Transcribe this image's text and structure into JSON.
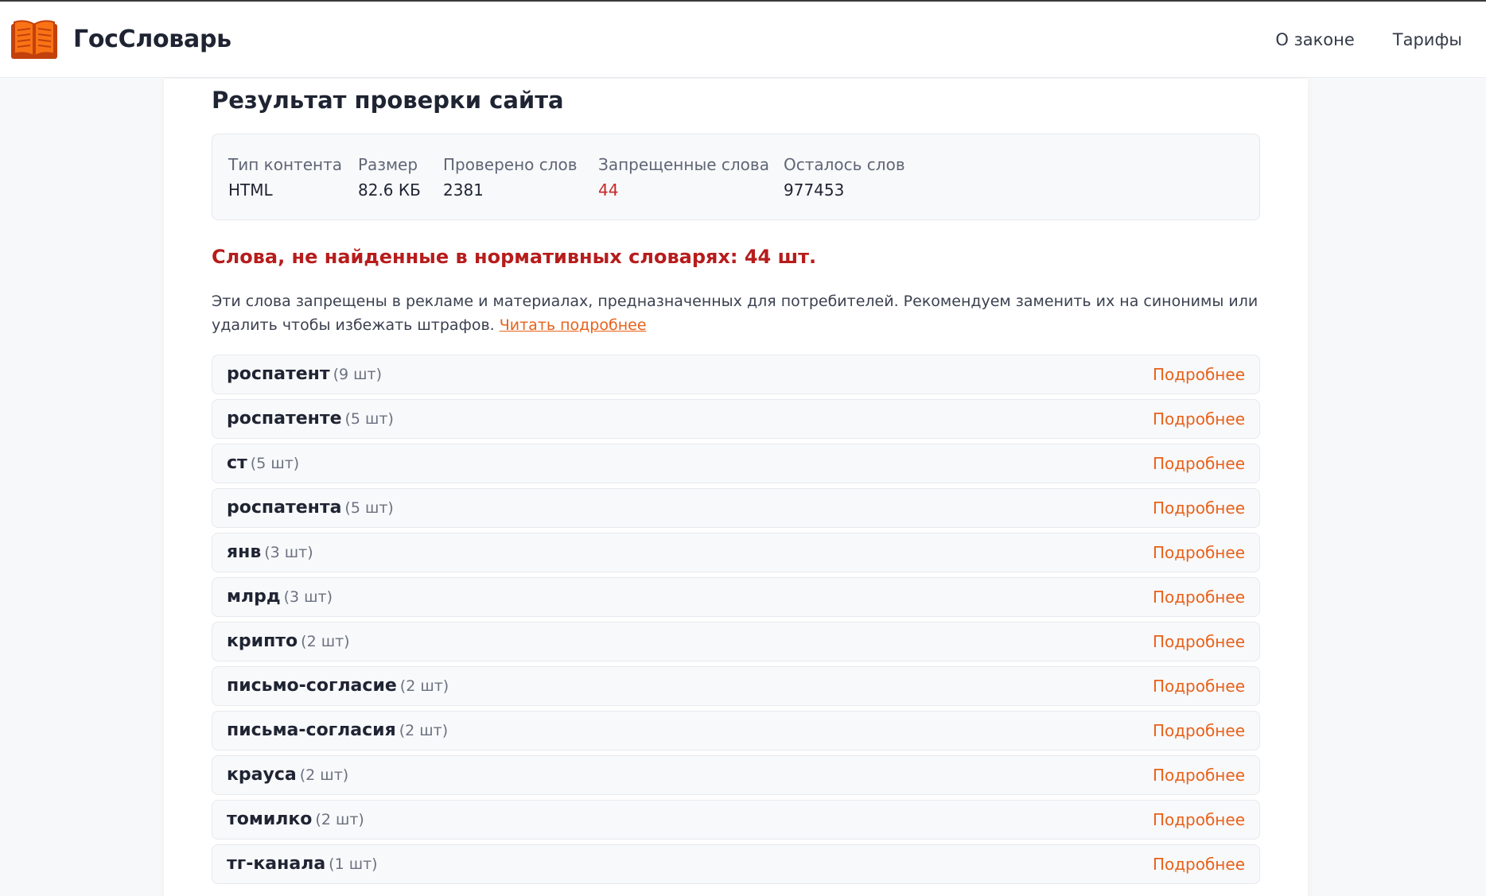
{
  "app": {
    "logo_text": "ГосСловарь",
    "logo_icon": "open-book-icon",
    "accent_color": "#e8611a",
    "danger_color": "#c62828"
  },
  "nav": {
    "items": [
      {
        "label": "О законе"
      },
      {
        "label": "Тарифы"
      }
    ]
  },
  "page": {
    "title": "Результат проверки сайта"
  },
  "stats": [
    {
      "label": "Тип контента",
      "value": "HTML"
    },
    {
      "label": "Размер",
      "value": "82.6 КБ"
    },
    {
      "label": "Проверено слов",
      "value": "2381"
    },
    {
      "label": "Запрещенные слова",
      "value": "44"
    },
    {
      "label": "Осталось слов",
      "value": "977453"
    }
  ],
  "warning": {
    "title": "Слова, не найденные в нормативных словарях: 44 шт.",
    "text": "Эти слова запрещены в рекламе и материалах, предназначенных для потребителей. Рекомендуем заменить их на синонимы или удалить чтобы избежать штрафов.",
    "link_label": "Читать подробнее"
  },
  "words": {
    "more_label": "Подробнее",
    "items": [
      {
        "word": "роспатент",
        "count": "(9 шт)"
      },
      {
        "word": "роспатенте",
        "count": "(5 шт)"
      },
      {
        "word": "ст",
        "count": "(5 шт)"
      },
      {
        "word": "роспатента",
        "count": "(5 шт)"
      },
      {
        "word": "янв",
        "count": "(3 шт)"
      },
      {
        "word": "млрд",
        "count": "(3 шт)"
      },
      {
        "word": "крипто",
        "count": "(2 шт)"
      },
      {
        "word": "письмо-согласие",
        "count": "(2 шт)"
      },
      {
        "word": "письма-согласия",
        "count": "(2 шт)"
      },
      {
        "word": "крауса",
        "count": "(2 шт)"
      },
      {
        "word": "томилко",
        "count": "(2 шт)"
      },
      {
        "word": "тг-канала",
        "count": "(1 шт)"
      }
    ]
  }
}
